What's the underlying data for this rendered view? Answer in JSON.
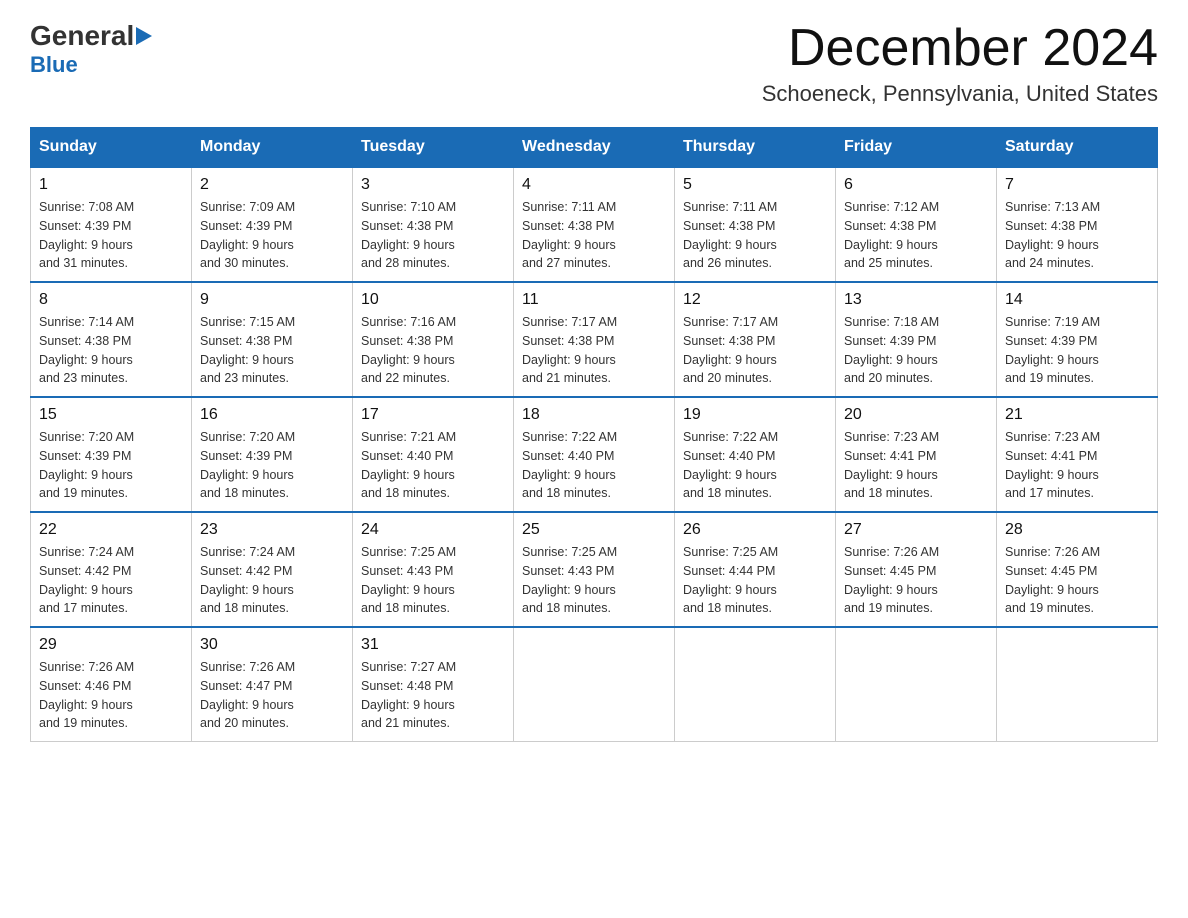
{
  "header": {
    "logo_line1": "General",
    "logo_line2": "Blue",
    "month_title": "December 2024",
    "location": "Schoeneck, Pennsylvania, United States"
  },
  "weekdays": [
    "Sunday",
    "Monday",
    "Tuesday",
    "Wednesday",
    "Thursday",
    "Friday",
    "Saturday"
  ],
  "weeks": [
    [
      {
        "day": "1",
        "sunrise": "7:08 AM",
        "sunset": "4:39 PM",
        "daylight": "9 hours and 31 minutes."
      },
      {
        "day": "2",
        "sunrise": "7:09 AM",
        "sunset": "4:39 PM",
        "daylight": "9 hours and 30 minutes."
      },
      {
        "day": "3",
        "sunrise": "7:10 AM",
        "sunset": "4:38 PM",
        "daylight": "9 hours and 28 minutes."
      },
      {
        "day": "4",
        "sunrise": "7:11 AM",
        "sunset": "4:38 PM",
        "daylight": "9 hours and 27 minutes."
      },
      {
        "day": "5",
        "sunrise": "7:11 AM",
        "sunset": "4:38 PM",
        "daylight": "9 hours and 26 minutes."
      },
      {
        "day": "6",
        "sunrise": "7:12 AM",
        "sunset": "4:38 PM",
        "daylight": "9 hours and 25 minutes."
      },
      {
        "day": "7",
        "sunrise": "7:13 AM",
        "sunset": "4:38 PM",
        "daylight": "9 hours and 24 minutes."
      }
    ],
    [
      {
        "day": "8",
        "sunrise": "7:14 AM",
        "sunset": "4:38 PM",
        "daylight": "9 hours and 23 minutes."
      },
      {
        "day": "9",
        "sunrise": "7:15 AM",
        "sunset": "4:38 PM",
        "daylight": "9 hours and 23 minutes."
      },
      {
        "day": "10",
        "sunrise": "7:16 AM",
        "sunset": "4:38 PM",
        "daylight": "9 hours and 22 minutes."
      },
      {
        "day": "11",
        "sunrise": "7:17 AM",
        "sunset": "4:38 PM",
        "daylight": "9 hours and 21 minutes."
      },
      {
        "day": "12",
        "sunrise": "7:17 AM",
        "sunset": "4:38 PM",
        "daylight": "9 hours and 20 minutes."
      },
      {
        "day": "13",
        "sunrise": "7:18 AM",
        "sunset": "4:39 PM",
        "daylight": "9 hours and 20 minutes."
      },
      {
        "day": "14",
        "sunrise": "7:19 AM",
        "sunset": "4:39 PM",
        "daylight": "9 hours and 19 minutes."
      }
    ],
    [
      {
        "day": "15",
        "sunrise": "7:20 AM",
        "sunset": "4:39 PM",
        "daylight": "9 hours and 19 minutes."
      },
      {
        "day": "16",
        "sunrise": "7:20 AM",
        "sunset": "4:39 PM",
        "daylight": "9 hours and 18 minutes."
      },
      {
        "day": "17",
        "sunrise": "7:21 AM",
        "sunset": "4:40 PM",
        "daylight": "9 hours and 18 minutes."
      },
      {
        "day": "18",
        "sunrise": "7:22 AM",
        "sunset": "4:40 PM",
        "daylight": "9 hours and 18 minutes."
      },
      {
        "day": "19",
        "sunrise": "7:22 AM",
        "sunset": "4:40 PM",
        "daylight": "9 hours and 18 minutes."
      },
      {
        "day": "20",
        "sunrise": "7:23 AM",
        "sunset": "4:41 PM",
        "daylight": "9 hours and 18 minutes."
      },
      {
        "day": "21",
        "sunrise": "7:23 AM",
        "sunset": "4:41 PM",
        "daylight": "9 hours and 17 minutes."
      }
    ],
    [
      {
        "day": "22",
        "sunrise": "7:24 AM",
        "sunset": "4:42 PM",
        "daylight": "9 hours and 17 minutes."
      },
      {
        "day": "23",
        "sunrise": "7:24 AM",
        "sunset": "4:42 PM",
        "daylight": "9 hours and 18 minutes."
      },
      {
        "day": "24",
        "sunrise": "7:25 AM",
        "sunset": "4:43 PM",
        "daylight": "9 hours and 18 minutes."
      },
      {
        "day": "25",
        "sunrise": "7:25 AM",
        "sunset": "4:43 PM",
        "daylight": "9 hours and 18 minutes."
      },
      {
        "day": "26",
        "sunrise": "7:25 AM",
        "sunset": "4:44 PM",
        "daylight": "9 hours and 18 minutes."
      },
      {
        "day": "27",
        "sunrise": "7:26 AM",
        "sunset": "4:45 PM",
        "daylight": "9 hours and 19 minutes."
      },
      {
        "day": "28",
        "sunrise": "7:26 AM",
        "sunset": "4:45 PM",
        "daylight": "9 hours and 19 minutes."
      }
    ],
    [
      {
        "day": "29",
        "sunrise": "7:26 AM",
        "sunset": "4:46 PM",
        "daylight": "9 hours and 19 minutes."
      },
      {
        "day": "30",
        "sunrise": "7:26 AM",
        "sunset": "4:47 PM",
        "daylight": "9 hours and 20 minutes."
      },
      {
        "day": "31",
        "sunrise": "7:27 AM",
        "sunset": "4:48 PM",
        "daylight": "9 hours and 21 minutes."
      },
      null,
      null,
      null,
      null
    ]
  ]
}
